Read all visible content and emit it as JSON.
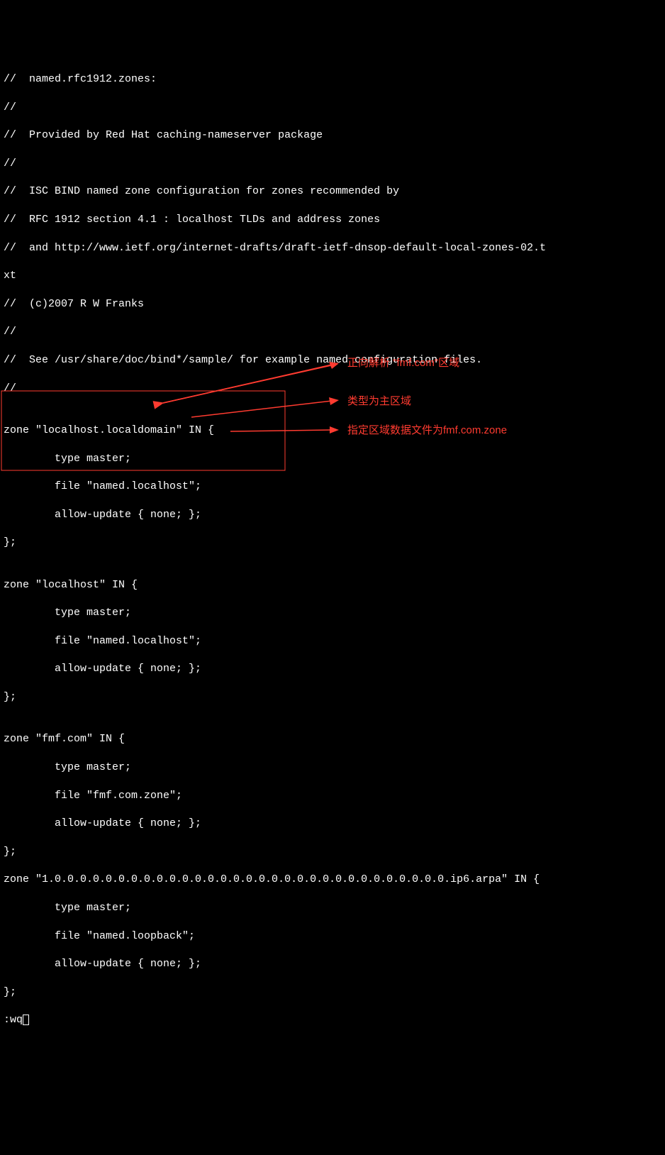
{
  "lines": {
    "l00": "//  named.rfc1912.zones:",
    "l01": "//",
    "l02": "//  Provided by Red Hat caching-nameserver package",
    "l03": "//",
    "l04": "//  ISC BIND named zone configuration for zones recommended by",
    "l05": "//  RFC 1912 section 4.1 : localhost TLDs and address zones",
    "l06": "//  and http://www.ietf.org/internet-drafts/draft-ietf-dnsop-default-local-zones-02.t",
    "l07": "xt",
    "l08": "//  (c)2007 R W Franks",
    "l09": "//",
    "l10": "//  See /usr/share/doc/bind*/sample/ for example named configuration files.",
    "l11": "//",
    "l12": "",
    "l13": "zone \"localhost.localdomain\" IN {",
    "l14": "        type master;",
    "l15": "        file \"named.localhost\";",
    "l16": "        allow-update { none; };",
    "l17": "};",
    "l18": "",
    "l19": "zone \"localhost\" IN {",
    "l20": "        type master;",
    "l21": "        file \"named.localhost\";",
    "l22": "        allow-update { none; };",
    "l23": "};",
    "l24": "",
    "l25": "zone \"fmf.com\" IN {",
    "l26": "        type master;",
    "l27": "        file \"fmf.com.zone\";",
    "l28": "        allow-update { none; };",
    "l29": "};",
    "l30": "zone \"1.0.0.0.0.0.0.0.0.0.0.0.0.0.0.0.0.0.0.0.0.0.0.0.0.0.0.0.0.0.0.0.ip6.arpa\" IN {",
    "l31": "        type master;",
    "l32": "        file \"named.loopback\";",
    "l33": "        allow-update { none; };",
    "l34": "};",
    "l35": ":wq"
  },
  "annotations": {
    "a1": "正向解析 \"fmf.com\"区域",
    "a2": "类型为主区域",
    "a3": "指定区域数据文件为fmf.com.zone"
  },
  "colors": {
    "red": "#ff3b30"
  }
}
